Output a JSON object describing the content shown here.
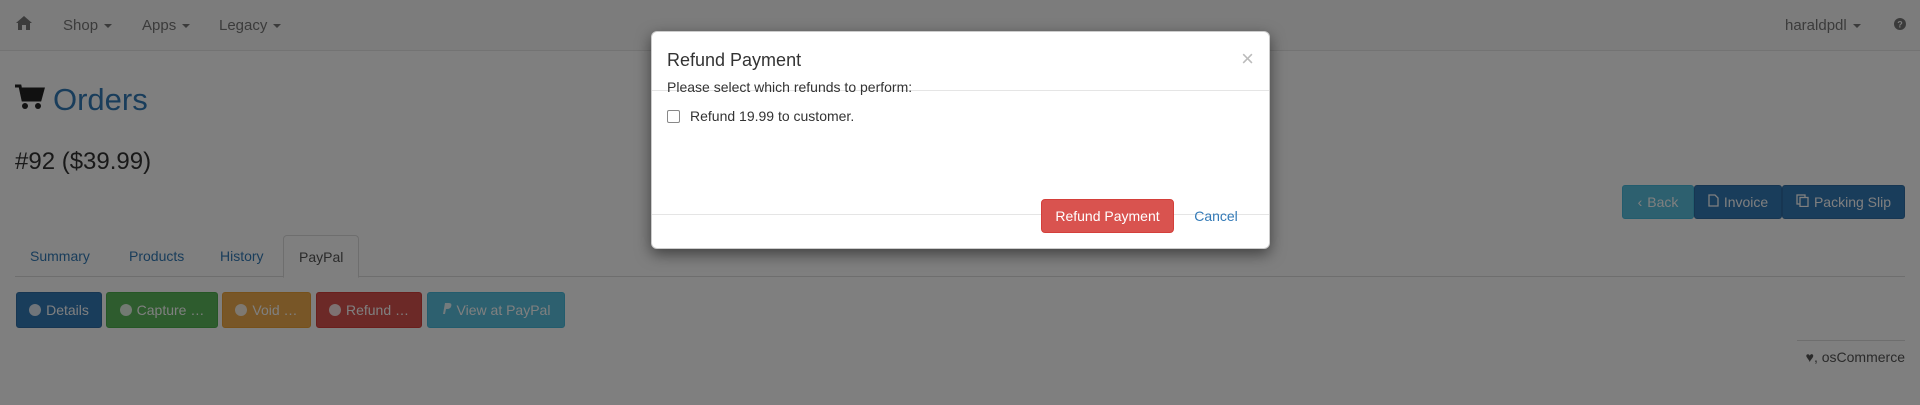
{
  "navbar": {
    "home_icon": "home-icon",
    "shop_label": "Shop",
    "apps_label": "Apps",
    "legacy_label": "Legacy",
    "user_label": "haraldpdl",
    "help_icon": "help-icon"
  },
  "page": {
    "title": "Orders",
    "title_icon": "cart-icon",
    "order_label": "#92 ($39.99)"
  },
  "actions": {
    "back_label": "Back",
    "invoice_label": "Invoice",
    "packing_slip_label": "Packing Slip"
  },
  "tabs": [
    "Summary",
    "Products",
    "History",
    "PayPal"
  ],
  "active_tab": "PayPal",
  "paypal_buttons": {
    "details": "Details",
    "capture": "Capture …",
    "void": "Void …",
    "refund": "Refund …",
    "view": "View at PayPal"
  },
  "footer": {
    "text": ", osCommerce",
    "icon": "heart-icon"
  },
  "modal": {
    "title": "Refund Payment",
    "close_label": "×",
    "prompt": "Please select which refunds to perform:",
    "option_label": "Refund 19.99 to customer.",
    "confirm_label": "Refund Payment",
    "cancel_label": "Cancel"
  },
  "colors": {
    "primary": "#337ab7",
    "success": "#5cb85c",
    "warning": "#f0ad4e",
    "danger": "#d9534f",
    "info": "#5bc0de"
  }
}
